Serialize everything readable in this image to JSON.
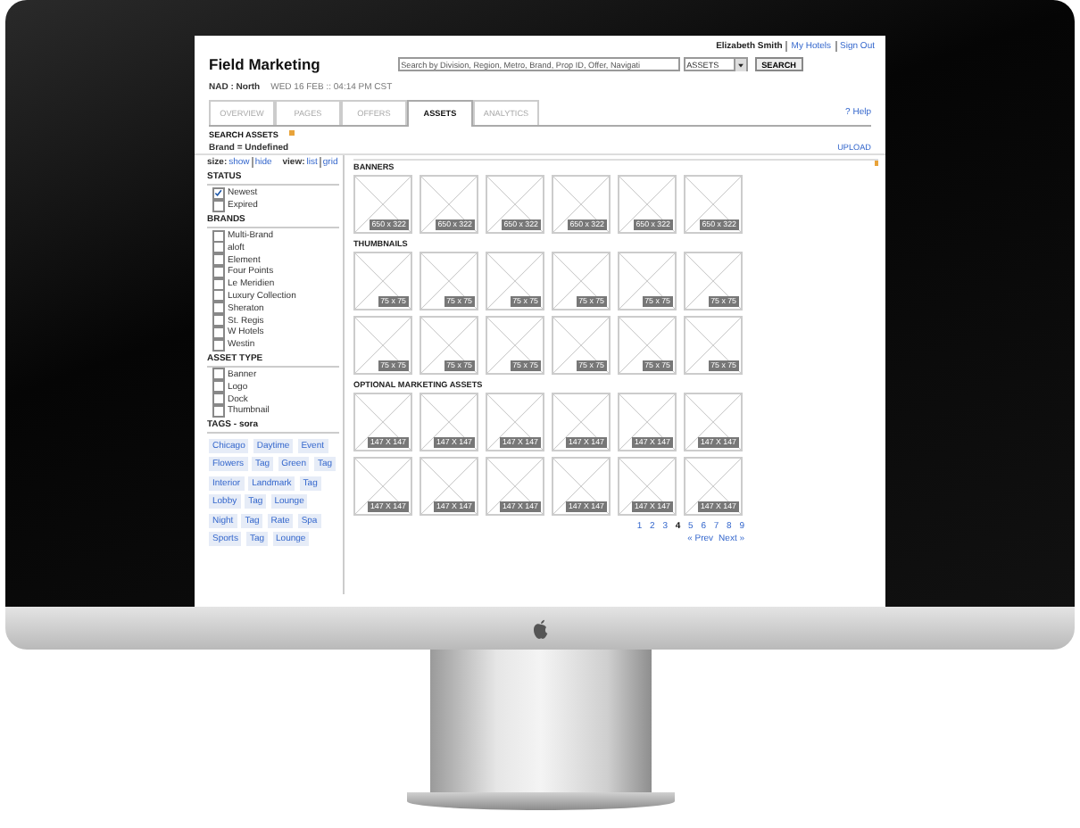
{
  "header": {
    "title": "Field Marketing",
    "search": {
      "placeholder": "Search by Division, Region, Metro, Brand, Prop ID, Offer, Navigati",
      "scope": "ASSETS",
      "button": "SEARCH"
    },
    "user_links": [
      "Elizabeth Smith",
      "My Hotels",
      "Sign Out"
    ],
    "region": "NAD : North",
    "datetime": "WED 16 FEB :: 04:14 PM CST"
  },
  "tabs": [
    {
      "label": "OVERVIEW",
      "selected": false
    },
    {
      "label": "PAGES",
      "selected": false
    },
    {
      "label": "OFFERS",
      "selected": false
    },
    {
      "label": "ASSETS",
      "selected": true
    },
    {
      "label": "ANALYTICS",
      "selected": false
    }
  ],
  "help": "? Help",
  "search_assets": {
    "title": "SEARCH ASSETS",
    "filter": "Brand = Undefined",
    "upload": "UPLOAD"
  },
  "sidebar": {
    "size": {
      "label": "size:",
      "links": [
        "show",
        "hide"
      ]
    },
    "view": {
      "label": "view:",
      "links": [
        "list",
        "grid"
      ]
    },
    "sections": [
      {
        "title": "STATUS",
        "kind": "checks",
        "items": [
          {
            "label": "Newest",
            "checked": true
          },
          {
            "label": "Expired",
            "checked": false
          }
        ]
      },
      {
        "title": "BRANDS",
        "kind": "checks",
        "items": [
          {
            "label": "Multi-Brand",
            "checked": false
          },
          {
            "label": "aloft",
            "checked": false
          },
          {
            "label": "Element",
            "checked": false
          },
          {
            "label": "Four Points",
            "checked": false
          },
          {
            "label": "Le Meridien",
            "checked": false
          },
          {
            "label": "Luxury Collection",
            "checked": false
          },
          {
            "label": "Sheraton",
            "checked": false
          },
          {
            "label": "St. Regis",
            "checked": false
          },
          {
            "label": "W Hotels",
            "checked": false
          },
          {
            "label": "Westin",
            "checked": false
          }
        ]
      },
      {
        "title": "ASSET TYPE",
        "kind": "checks",
        "items": [
          {
            "label": "Banner",
            "checked": false
          },
          {
            "label": "Logo",
            "checked": false
          },
          {
            "label": "Dock",
            "checked": false
          },
          {
            "label": "Thumbnail",
            "checked": false
          }
        ]
      },
      {
        "title": "TAGS - sora",
        "kind": "tags",
        "items": [
          "Chicago",
          "Daytime",
          "Event",
          "Flowers",
          "Tag",
          "Green",
          "Tag",
          "Interior",
          "Landmark",
          "Tag",
          "Lobby",
          "Tag",
          "Lounge",
          "Night",
          "Tag",
          "Rate",
          "Spa",
          "Sports",
          "Tag",
          "Lounge"
        ]
      }
    ]
  },
  "main": {
    "sections": [
      {
        "title": "BANNERS",
        "tiles": [
          "650 x 322",
          "650 x 322",
          "650 x 322",
          "650 x 322",
          "650 x 322",
          "650 x 322"
        ]
      },
      {
        "title": "THUMBNAILS",
        "tiles": [
          "75 x 75",
          "75 x 75",
          "75 x 75",
          "75 x 75",
          "75 x 75",
          "75 x 75",
          "75 x 75",
          "75 x 75",
          "75 x 75",
          "75 x 75",
          "75 x 75",
          "75 x 75"
        ]
      },
      {
        "title": "OPTIONAL MARKETING ASSETS",
        "tiles": [
          "147 X 147",
          "147 X 147",
          "147 X 147",
          "147 X 147",
          "147 X 147",
          "147 X 147",
          "147 X 147",
          "147 X 147",
          "147 X 147",
          "147 X 147",
          "147 X 147",
          "147 X 147"
        ]
      }
    ]
  },
  "pagination": {
    "pages": [
      {
        "label": "1",
        "selected": false
      },
      {
        "label": "2",
        "selected": false
      },
      {
        "label": "3",
        "selected": false
      },
      {
        "label": "4",
        "selected": true
      },
      {
        "label": "5",
        "selected": false
      },
      {
        "label": "6",
        "selected": false
      },
      {
        "label": "7",
        "selected": false
      },
      {
        "label": "8",
        "selected": false
      },
      {
        "label": "9",
        "selected": false
      }
    ],
    "prev": "« Prev",
    "next": "Next »"
  }
}
